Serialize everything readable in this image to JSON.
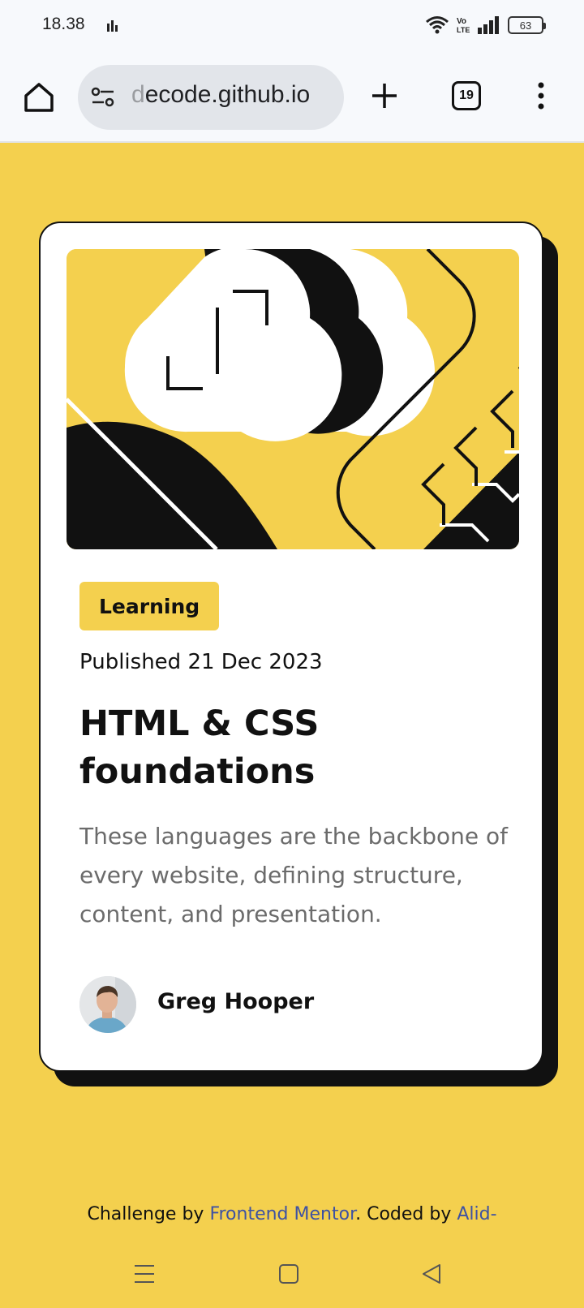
{
  "status_bar": {
    "time": "18.38",
    "battery": "63",
    "icons": [
      "activity-icon",
      "wifi-icon",
      "volte-icon",
      "signal-icon",
      "battery-icon"
    ]
  },
  "browser": {
    "url_faded": "d",
    "url_rest": "ecode.github.io",
    "tab_count": "19",
    "icons": [
      "home-icon",
      "site-settings-icon",
      "plus-icon",
      "tabs-icon",
      "more-vert-icon"
    ]
  },
  "card": {
    "tag": "Learning",
    "published": "Published 21 Dec 2023",
    "title": "HTML & CSS foundations",
    "description": "These languages are the backbone of every website, defining structure, content, and presentation.",
    "author": "Greg Hooper"
  },
  "footer": {
    "prefix": "Challenge by ",
    "link1": "Frontend Mentor",
    "middle": ". Coded by ",
    "link2": "Alid-decode"
  },
  "nav_bar": {
    "icons": [
      "menu-icon",
      "home-square-icon",
      "back-triangle-icon"
    ]
  },
  "colors": {
    "background": "#f4d04e",
    "text": "#111111",
    "muted": "#6b6b6b",
    "link": "#3e52a3"
  }
}
